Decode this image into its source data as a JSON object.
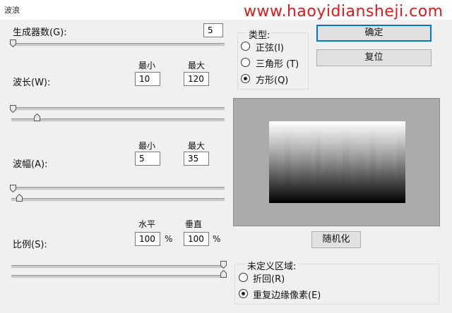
{
  "window": {
    "title": "波浪"
  },
  "watermark": "www.haoyidiansheji.com",
  "generators": {
    "label": "生成器数(G):",
    "value": "5"
  },
  "wavelength": {
    "label": "波长(W):",
    "min_header": "最小",
    "max_header": "最大",
    "min": "10",
    "max": "120"
  },
  "amplitude": {
    "label": "波幅(A):",
    "min_header": "最小",
    "max_header": "最大",
    "min": "5",
    "max": "35"
  },
  "scale": {
    "label": "比例(S):",
    "h_header": "水平",
    "v_header": "垂直",
    "h": "100",
    "v": "100",
    "unit": "%"
  },
  "type": {
    "title": "类型:",
    "options": [
      {
        "label": "正弦(I)",
        "selected": false
      },
      {
        "label": "三角形 (T)",
        "selected": false
      },
      {
        "label": "方形(Q)",
        "selected": true
      }
    ]
  },
  "buttons": {
    "ok": "确定",
    "reset": "复位",
    "randomize": "随机化"
  },
  "undefined_area": {
    "title": "未定义区域:",
    "options": [
      {
        "label": "折回(R)",
        "selected": false
      },
      {
        "label": "重复边缘像素(E)",
        "selected": true
      }
    ]
  },
  "colors": {
    "watermark": "#e0191a",
    "default_button_border": "#0078d7",
    "dialog_bg": "#f0f0f0",
    "preview_bg": "#ababab"
  }
}
